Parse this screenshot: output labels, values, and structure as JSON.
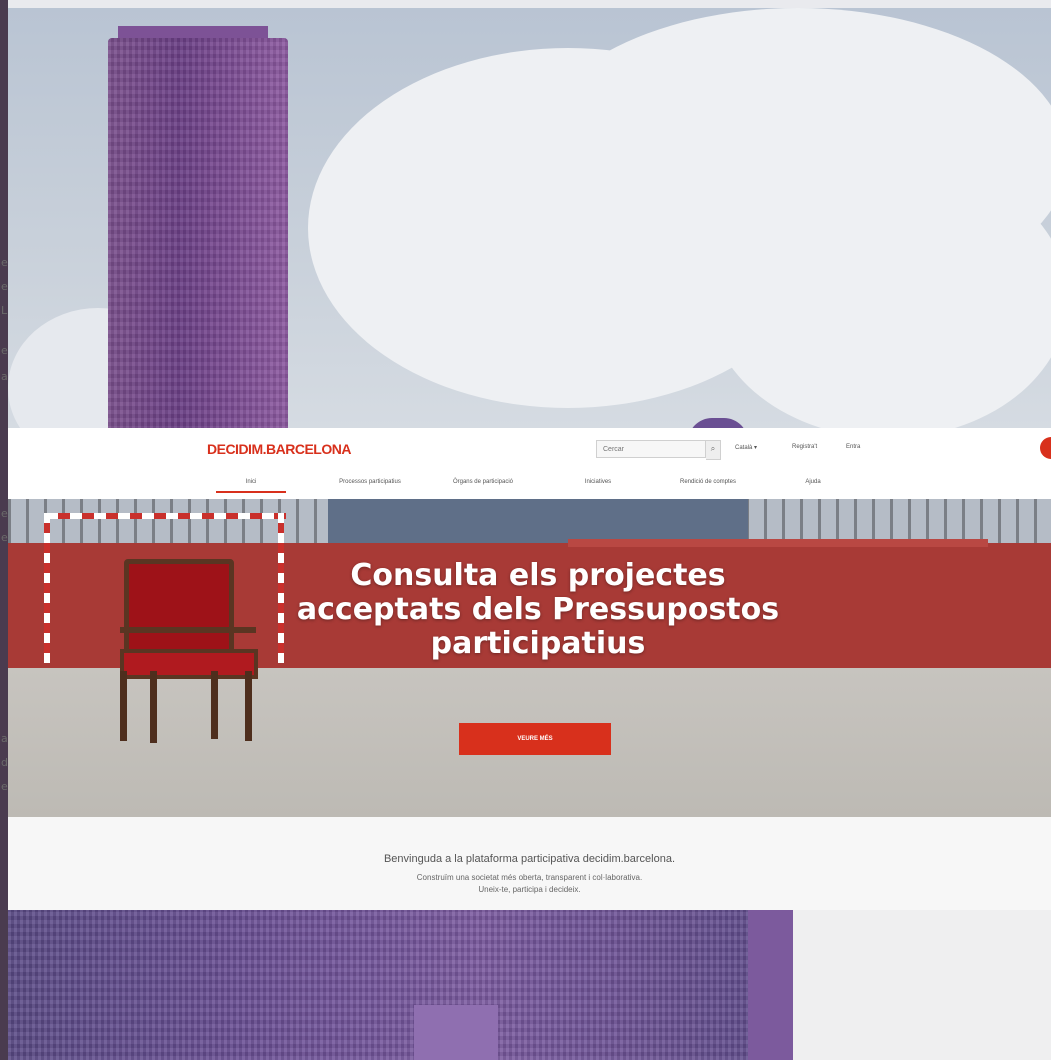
{
  "left_edge_letters": [
    "e",
    "e",
    "L",
    "e",
    "a",
    "e",
    "e",
    "a",
    "d",
    "e"
  ],
  "site": {
    "logo": "DECIDIM.BARCELONA",
    "search": {
      "placeholder": "Cercar"
    },
    "header_links": {
      "language": "Català ▾",
      "register": "Registra't",
      "login": "Entra"
    },
    "nav_items": [
      "Inici",
      "Processos participatius",
      "Òrgans de participació",
      "Iniciatives",
      "Rendició de comptes",
      "Ajuda"
    ],
    "nav_active_index": 0,
    "hero": {
      "title_line1": "Consulta els projectes",
      "title_line2": "acceptats dels Pressupostos",
      "title_line3": "participatius",
      "button_label": "VEURE MÉS"
    },
    "welcome": {
      "title": "Benvinguda a la plataforma participativa decidim.barcelona.",
      "line1": "Construïm una societat més oberta, transparent i col·laborativa.",
      "line2": "Uneix-te, participa i decideix."
    }
  },
  "colors": {
    "brand_red": "#d8301c",
    "tower_purple": "#6b3f86"
  }
}
